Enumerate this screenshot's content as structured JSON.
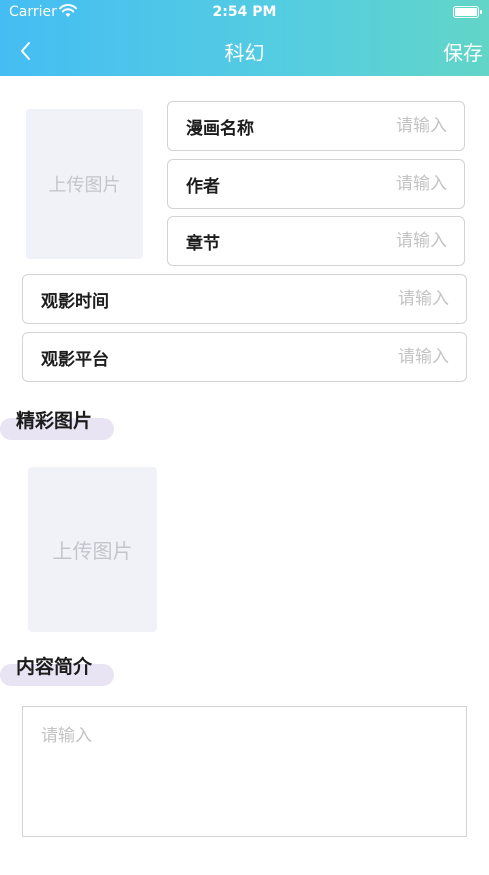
{
  "status_bar": {
    "carrier": "Carrier",
    "time": "2:54 PM"
  },
  "navbar": {
    "title": "科幻",
    "save_label": "保存",
    "back_icon": "chevron-left-icon"
  },
  "cover_upload": {
    "label": "上传图片"
  },
  "fields": [
    {
      "label": "漫画名称",
      "placeholder": "请输入"
    },
    {
      "label": "作者",
      "placeholder": "请输入"
    },
    {
      "label": "章节",
      "placeholder": "请输入"
    },
    {
      "label": "观影时间",
      "placeholder": "请输入"
    },
    {
      "label": "观影平台",
      "placeholder": "请输入"
    }
  ],
  "gallery": {
    "title": "精彩图片",
    "upload_label": "上传图片"
  },
  "intro": {
    "title": "内容简介",
    "placeholder": "请输入"
  },
  "colors": {
    "header_start": "#45bdf3",
    "header_end": "#62d5c8",
    "section_pill": "#e8e4f4",
    "upload_bg": "#f1f2f8"
  }
}
